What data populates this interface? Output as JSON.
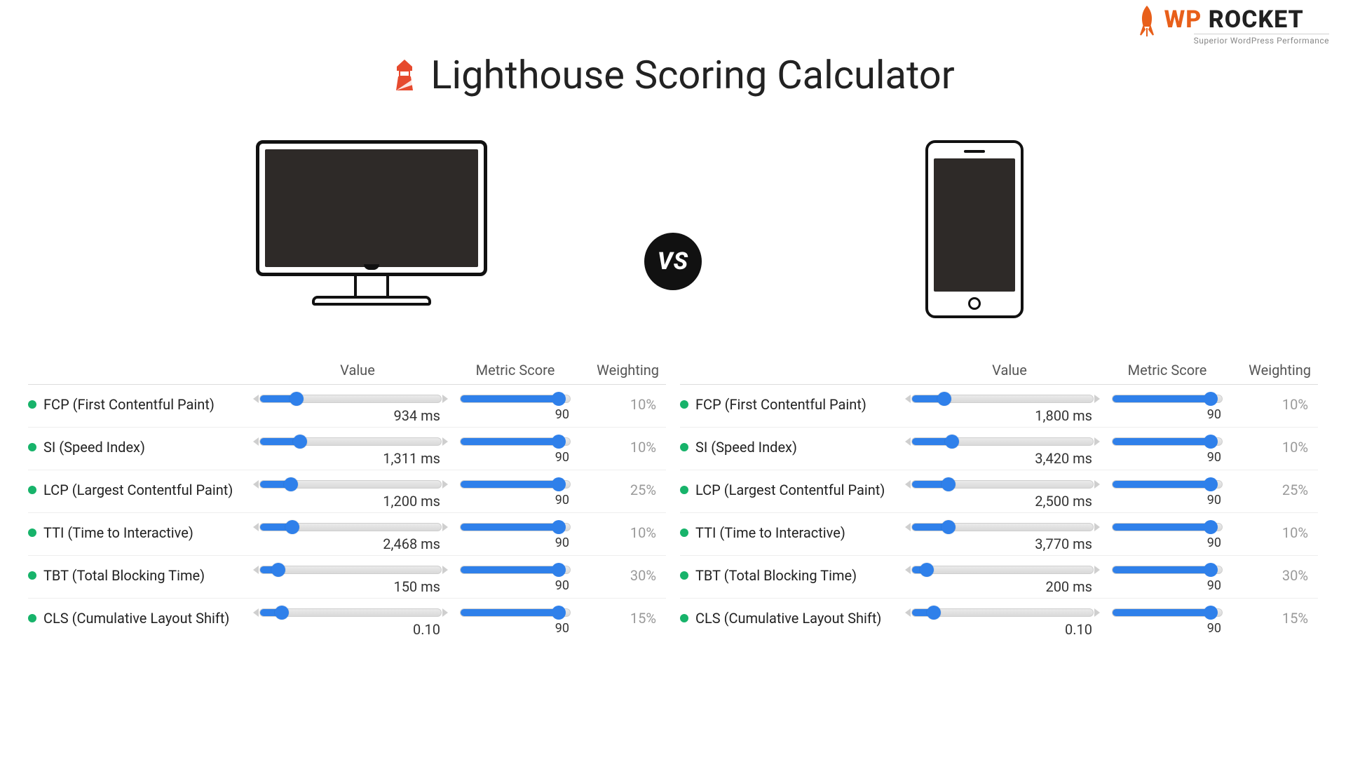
{
  "brand": {
    "wp": "WP",
    "rocket": "ROCKET",
    "tagline": "Superior WordPress Performance"
  },
  "title": "Lighthouse Scoring Calculator",
  "vs_label": "VS",
  "columns": {
    "value": "Value",
    "score": "Metric Score",
    "weight": "Weighting"
  },
  "desktop": {
    "metrics": [
      {
        "name": "FCP (First Contentful Paint)",
        "value": "934 ms",
        "pos": 20,
        "score": "90",
        "score_pos": 90,
        "weight": "10%"
      },
      {
        "name": "SI (Speed Index)",
        "value": "1,311 ms",
        "pos": 22,
        "score": "90",
        "score_pos": 90,
        "weight": "10%"
      },
      {
        "name": "LCP (Largest Contentful Paint)",
        "value": "1,200 ms",
        "pos": 17,
        "score": "90",
        "score_pos": 90,
        "weight": "25%"
      },
      {
        "name": "TTI (Time to Interactive)",
        "value": "2,468 ms",
        "pos": 18,
        "score": "90",
        "score_pos": 90,
        "weight": "10%"
      },
      {
        "name": "TBT (Total Blocking Time)",
        "value": "150 ms",
        "pos": 10,
        "score": "90",
        "score_pos": 90,
        "weight": "30%"
      },
      {
        "name": "CLS (Cumulative Layout Shift)",
        "value": "0.10",
        "pos": 12,
        "score": "90",
        "score_pos": 90,
        "weight": "15%"
      }
    ]
  },
  "mobile": {
    "metrics": [
      {
        "name": "FCP (First Contentful Paint)",
        "value": "1,800 ms",
        "pos": 18,
        "score": "90",
        "score_pos": 90,
        "weight": "10%"
      },
      {
        "name": "SI (Speed Index)",
        "value": "3,420 ms",
        "pos": 22,
        "score": "90",
        "score_pos": 90,
        "weight": "10%"
      },
      {
        "name": "LCP (Largest Contentful Paint)",
        "value": "2,500 ms",
        "pos": 20,
        "score": "90",
        "score_pos": 90,
        "weight": "25%"
      },
      {
        "name": "TTI (Time to Interactive)",
        "value": "3,770 ms",
        "pos": 20,
        "score": "90",
        "score_pos": 90,
        "weight": "10%"
      },
      {
        "name": "TBT (Total Blocking Time)",
        "value": "200 ms",
        "pos": 8,
        "score": "90",
        "score_pos": 90,
        "weight": "30%"
      },
      {
        "name": "CLS (Cumulative Layout Shift)",
        "value": "0.10",
        "pos": 12,
        "score": "90",
        "score_pos": 90,
        "weight": "15%"
      }
    ]
  }
}
